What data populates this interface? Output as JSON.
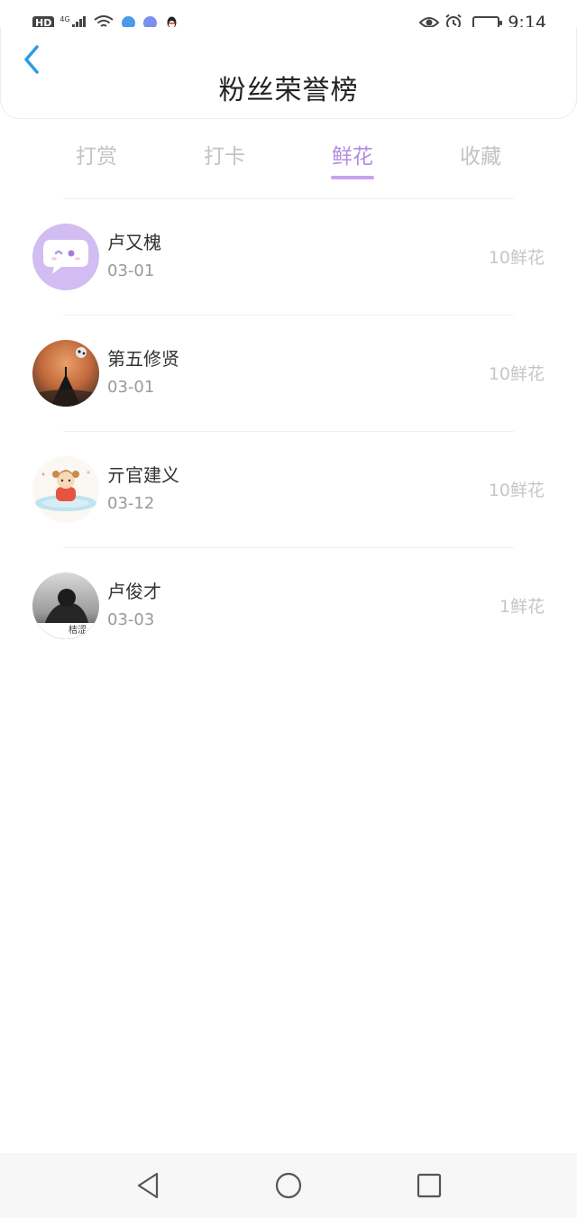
{
  "status_bar": {
    "hd": "HD",
    "network": "4G",
    "time": "9:14"
  },
  "header": {
    "title": "粉丝荣誉榜",
    "back_icon": "chevron-left-icon",
    "accent": "#2a9de4"
  },
  "tabs": [
    {
      "label": "打赏",
      "active": false
    },
    {
      "label": "打卡",
      "active": false
    },
    {
      "label": "鲜花",
      "active": true
    },
    {
      "label": "收藏",
      "active": false
    }
  ],
  "tab_active_color": "#b18de0",
  "fans": [
    {
      "name": "卢又槐",
      "date": "03-01",
      "score": "10鲜花"
    },
    {
      "name": "第五修贤",
      "date": "03-01",
      "score": "10鲜花"
    },
    {
      "name": "亓官建义",
      "date": "03-12",
      "score": "10鲜花"
    },
    {
      "name": "卢俊才",
      "date": "03-03",
      "score": "1鲜花",
      "avatar_caption": "桔涩"
    }
  ]
}
